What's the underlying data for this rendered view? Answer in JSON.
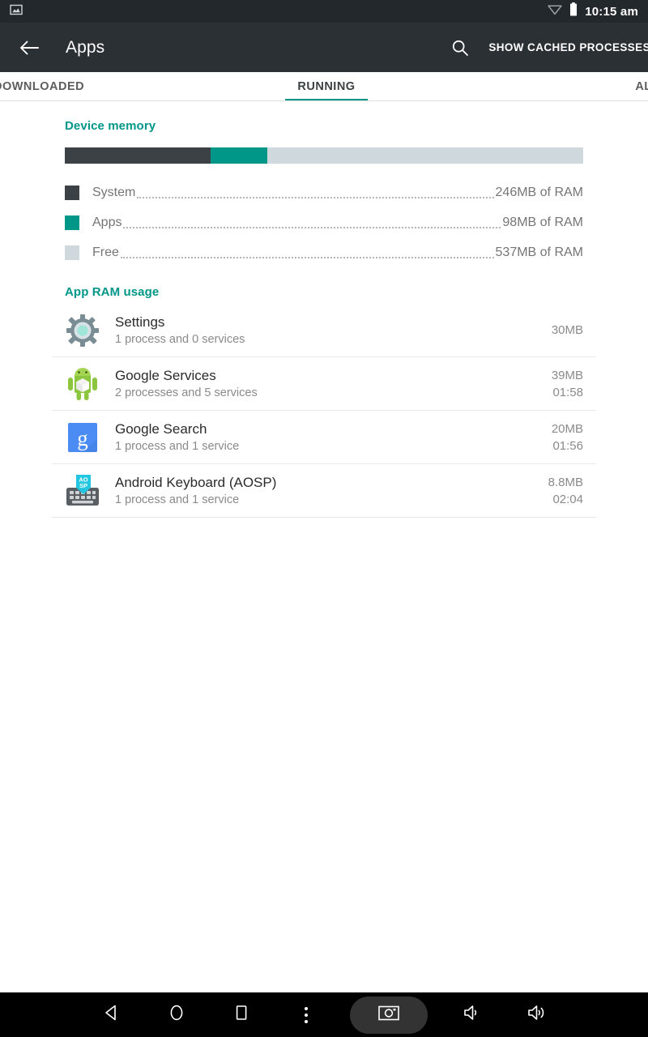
{
  "status_bar": {
    "notification_icon": "screenshot-image-icon",
    "wifi_icon": "wifi-icon",
    "battery_icon": "battery-full-icon",
    "clock": "10:15 am"
  },
  "action_bar": {
    "back_icon": "back-arrow-icon",
    "title": "Apps",
    "search_icon": "search-icon",
    "cached_label": "SHOW CACHED PROCESSES"
  },
  "tabs": [
    {
      "label": "DOWNLOADED",
      "active": false
    },
    {
      "label": "RUNNING",
      "active": true
    },
    {
      "label": "ALL",
      "active": false
    }
  ],
  "device_memory": {
    "header": "Device memory",
    "bar": {
      "system_pct": 28.1,
      "apps_pct": 10.9,
      "free_pct": 61.0
    },
    "legend": [
      {
        "label": "System",
        "value": "246MB of RAM",
        "color": "#3c4145"
      },
      {
        "label": "Apps",
        "value": "98MB of RAM",
        "color": "#009688"
      },
      {
        "label": "Free",
        "value": "537MB of RAM",
        "color": "#cfd8dc"
      }
    ]
  },
  "app_ram_usage": {
    "header": "App RAM usage",
    "rows": [
      {
        "icon": "settings-gear-icon",
        "name": "Settings",
        "subtitle": "1 process and 0 services",
        "size": "30MB",
        "time": ""
      },
      {
        "icon": "android-robot-icon",
        "name": "Google Services",
        "subtitle": "2 processes and 5 services",
        "size": "39MB",
        "time": "01:58"
      },
      {
        "icon": "google-search-g-icon",
        "name": "Google Search",
        "subtitle": "1 process and 1 service",
        "size": "20MB",
        "time": "01:56"
      },
      {
        "icon": "android-keyboard-icon",
        "name": "Android Keyboard (AOSP)",
        "subtitle": "1 process and 1 service",
        "size": "8.8MB",
        "time": "02:04"
      }
    ]
  },
  "nav_bar": {
    "buttons": [
      {
        "icon": "back-triangle-icon",
        "name": "nav-back-button"
      },
      {
        "icon": "home-circle-icon",
        "name": "nav-home-button"
      },
      {
        "icon": "recents-square-icon",
        "name": "nav-recents-button"
      },
      {
        "icon": "overflow-menu-icon",
        "name": "nav-menu-button"
      },
      {
        "icon": "camera-screenshot-icon",
        "name": "nav-screenshot-button"
      },
      {
        "icon": "volume-down-icon",
        "name": "nav-volume-down-button"
      },
      {
        "icon": "volume-up-icon",
        "name": "nav-volume-up-button"
      }
    ]
  },
  "colors": {
    "accent_teal": "#009688",
    "action_bar": "#2b3035",
    "status_bar": "#23282d",
    "system_dark": "#3c4145",
    "free_gray": "#cfd8dc"
  }
}
